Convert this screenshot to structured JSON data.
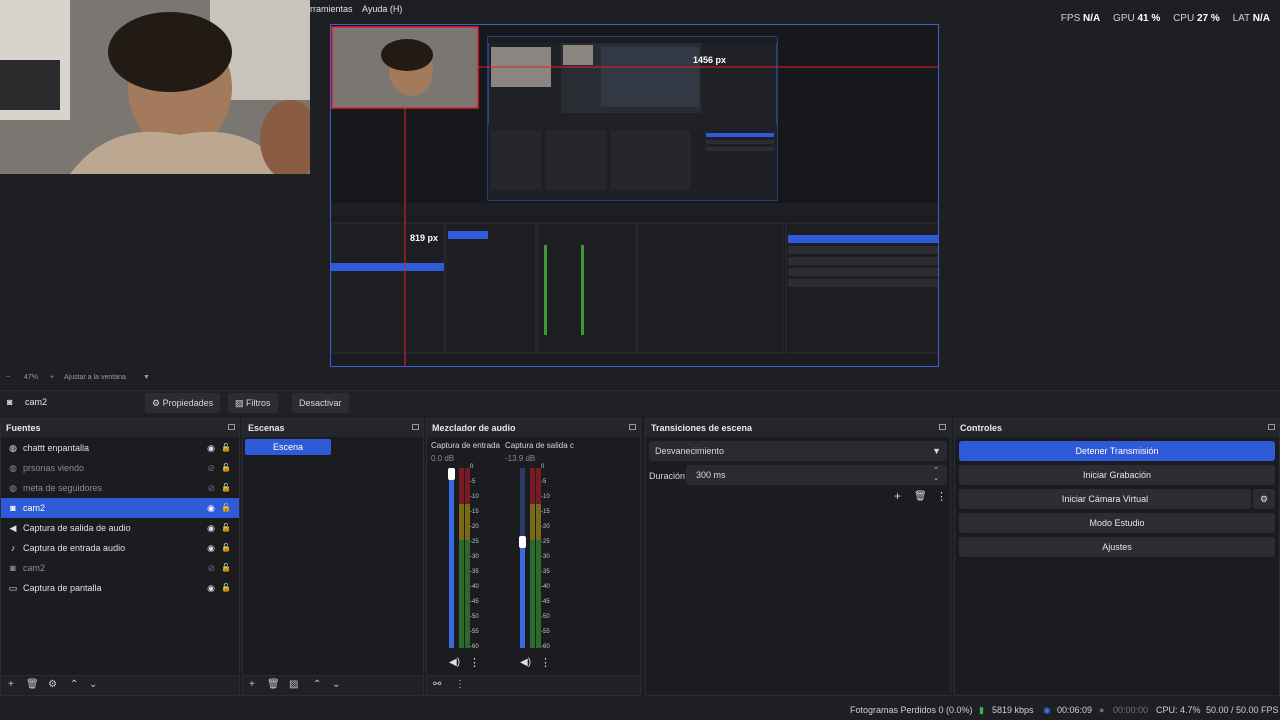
{
  "menu": {
    "items": [
      "rramientas",
      "Ayuda (H)"
    ]
  },
  "stats": {
    "fps_label": "FPS",
    "fps_value": "N/A",
    "gpu_label": "GPU",
    "gpu_value": "41 %",
    "cpu_label": "CPU",
    "cpu_value": "27 %",
    "lat_label": "LAT",
    "lat_value": "N/A"
  },
  "preview": {
    "measure_h": "1456 px",
    "measure_v": "819 px"
  },
  "zoom": {
    "level": "47%",
    "fit_label": "Ajustar a la ventana"
  },
  "context_bar": {
    "source_name": "cam2",
    "properties_label": "Propiedades",
    "filters_label": "Filtros",
    "deactivate_label": "Desactivar"
  },
  "sources": {
    "title": "Fuentes",
    "items": [
      {
        "label": "chattt enpantalla",
        "icon": "globe-icon",
        "visible": true,
        "selected": false
      },
      {
        "label": "prsonas viendo",
        "icon": "globe-icon",
        "visible": false,
        "selected": false
      },
      {
        "label": "meta de seguidores",
        "icon": "globe-icon",
        "visible": false,
        "selected": false
      },
      {
        "label": "cam2",
        "icon": "camera-icon",
        "visible": true,
        "selected": true
      },
      {
        "label": "Captura de salida de audio",
        "icon": "speaker-icon",
        "visible": true,
        "selected": false
      },
      {
        "label": "Captura de entrada audio",
        "icon": "microphone-icon",
        "visible": true,
        "selected": false
      },
      {
        "label": "cam2",
        "icon": "camera-icon",
        "visible": false,
        "selected": false
      },
      {
        "label": "Captura de pantalla",
        "icon": "monitor-icon",
        "visible": true,
        "selected": false
      }
    ]
  },
  "scenes": {
    "title": "Escenas",
    "items": [
      "Escena"
    ]
  },
  "mixer": {
    "title": "Mezclador de audio",
    "channels": [
      {
        "name": "Captura de entrada",
        "db": "0.0 dB",
        "fader": 1.0
      },
      {
        "name": "Captura de salida c",
        "db": "-13.9 dB",
        "fader": 0.62
      }
    ],
    "scale": [
      "0",
      "-5",
      "-10",
      "-15",
      "-20",
      "-25",
      "-30",
      "-35",
      "-40",
      "-45",
      "-50",
      "-55",
      "-60"
    ]
  },
  "transitions": {
    "title": "Transiciones de escena",
    "selected": "Desvanecimiento",
    "duration_label": "Duración",
    "duration_value": "300 ms"
  },
  "controls": {
    "title": "Controles",
    "buttons": [
      "Detener Transmisión",
      "Iniciar Grabación",
      "Iniciar Cámara Virtual",
      "Modo Estudio",
      "Ajustes"
    ]
  },
  "status": {
    "dropped": "Fotogramas Perdidos 0 (0.0%)",
    "bitrate": "5819 kbps",
    "stream_time": "00:06:09",
    "rec_time": "00:00:00",
    "cpu": "CPU: 4.7%",
    "fps": "50.00 / 50.00 FPS"
  },
  "colors": {
    "accent": "#2f5ad8",
    "guide_red": "#e0202a",
    "preview_border": "#3a60d8"
  }
}
